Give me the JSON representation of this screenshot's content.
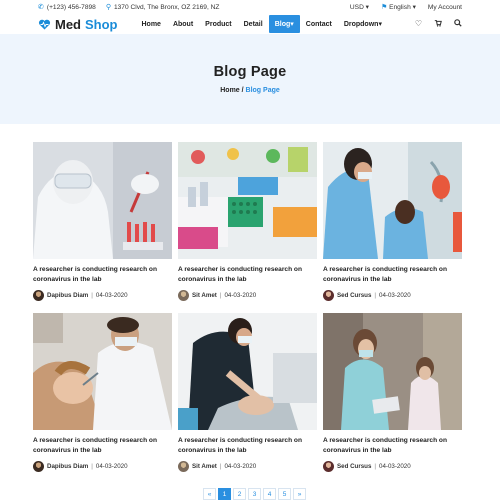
{
  "topbar": {
    "phone": "(+123) 456-7898",
    "address": "1370 Clvd, The Bronx, OZ 2169, NZ",
    "currency": "USD",
    "language": "English",
    "account": "My Account"
  },
  "brand": {
    "part1": "Med",
    "part2": "Shop"
  },
  "nav": {
    "items": [
      "Home",
      "About",
      "Product",
      "Detail",
      "Blog",
      "Contact",
      "Dropdown"
    ],
    "active": "Blog"
  },
  "hero": {
    "title": "Blog Page",
    "breadcrumb": {
      "home": "Home",
      "separator": " / ",
      "current": "Blog Page"
    }
  },
  "posts": [
    {
      "title": "A researcher is conducting research on coronavirus in the lab",
      "author": "Dapibus Diam",
      "date": "04-03-2020",
      "image": "lab-researcher-test-tubes"
    },
    {
      "title": "A researcher is conducting research on coronavirus in the lab",
      "author": "Sit Amet",
      "date": "04-03-2020",
      "image": "lab-samples-tray"
    },
    {
      "title": "A researcher is conducting research on coronavirus in the lab",
      "author": "Sed Cursus",
      "date": "04-03-2020",
      "image": "dentist-with-patient"
    },
    {
      "title": "A researcher is conducting research on coronavirus in the lab",
      "author": "Dapibus Diam",
      "date": "04-03-2020",
      "image": "dentist-examining-child"
    },
    {
      "title": "A researcher is conducting research on coronavirus in the lab",
      "author": "Sit Amet",
      "date": "04-03-2020",
      "image": "dental-exam-chair"
    },
    {
      "title": "A researcher is conducting research on coronavirus in the lab",
      "author": "Sed Cursus",
      "date": "04-03-2020",
      "image": "nurse-with-clipboard"
    }
  ],
  "pagination": {
    "prev": "«",
    "pages": [
      "1",
      "2",
      "3",
      "4",
      "5"
    ],
    "next": "»",
    "active": "1"
  },
  "colors": {
    "accent": "#2a8fe0",
    "hero_bg": "#eef5fd"
  }
}
